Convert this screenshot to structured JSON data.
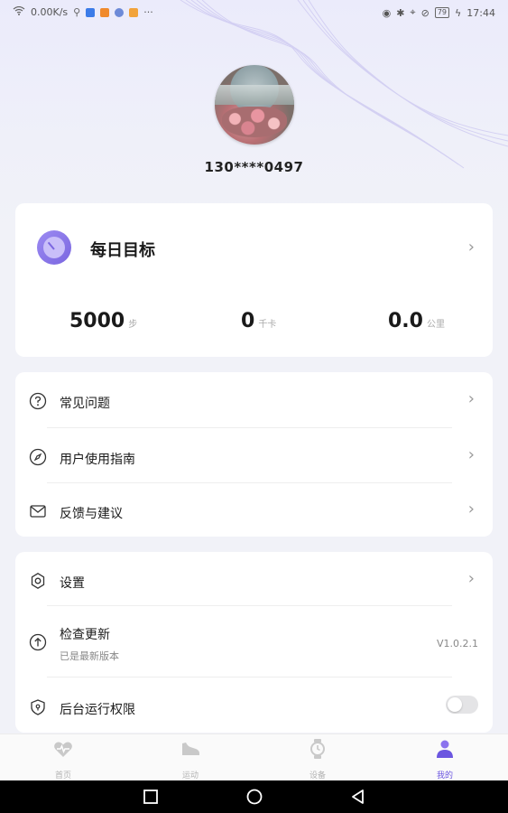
{
  "status_bar": {
    "speed": "0.00K/s",
    "time": "17:44",
    "battery": "79"
  },
  "profile": {
    "phone": "130****0497"
  },
  "goal": {
    "title": "每日目标",
    "steps": {
      "value": "5000",
      "unit": "步"
    },
    "calories": {
      "value": "0",
      "unit": "千卡"
    },
    "distance": {
      "value": "0.0",
      "unit": "公里"
    }
  },
  "menu": {
    "items": [
      {
        "label": "常见问题"
      },
      {
        "label": "用户使用指南"
      },
      {
        "label": "反馈与建议"
      }
    ]
  },
  "settings": {
    "settings_label": "设置",
    "update_label": "检查更新",
    "update_status": "已是最新版本",
    "version": "V1.0.2.1",
    "background_label": "后台运行权限",
    "background_enabled": false
  },
  "tabs": [
    {
      "label": "首页",
      "icon": "heart-pulse-icon"
    },
    {
      "label": "运动",
      "icon": "shoe-icon"
    },
    {
      "label": "设备",
      "icon": "watch-icon"
    },
    {
      "label": "我的",
      "icon": "person-icon"
    }
  ],
  "colors": {
    "accent": "#6b56e0",
    "background": "#f1f2f8"
  }
}
